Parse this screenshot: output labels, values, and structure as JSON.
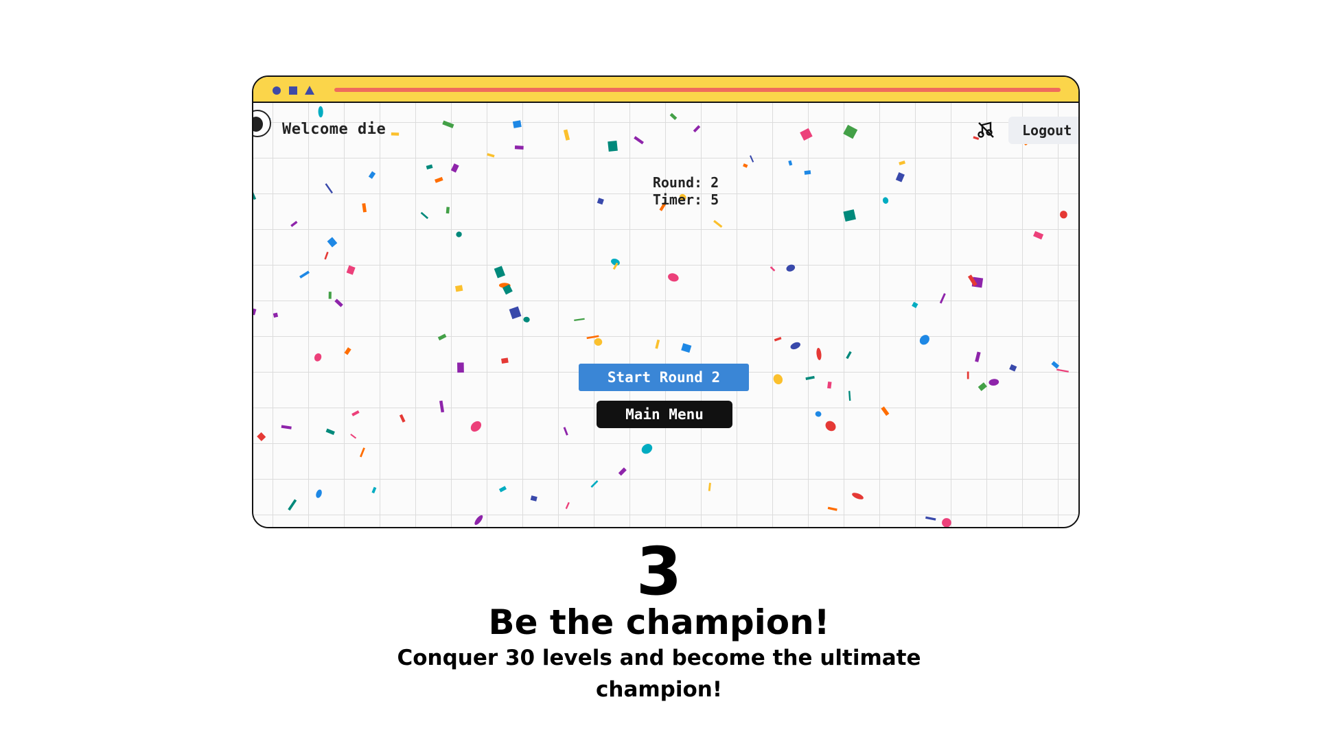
{
  "game": {
    "welcome_text": "Welcome die",
    "logout_label": "Logout",
    "round_text": "Round: 2",
    "timer_text": "Timer: 5",
    "start_round_label": "Start Round 2",
    "main_menu_label": "Main Menu",
    "music_icon": "music-off-icon"
  },
  "caption": {
    "number": "3",
    "headline": "Be the champion!",
    "subtext": "Conquer 30 levels and become the ultimate champion!"
  },
  "colors": {
    "titlebar": "#fbd54a",
    "urlbar": "#ef6b5c",
    "window_controls": "#3f4aa6",
    "start_button": "#3a86d6",
    "main_menu_button": "#111111",
    "confetti": [
      "#e53935",
      "#fbc02d",
      "#1e88e5",
      "#43a047",
      "#8e24aa",
      "#00acc1",
      "#ff6d00",
      "#3949ab",
      "#ec407a",
      "#00897b"
    ]
  }
}
